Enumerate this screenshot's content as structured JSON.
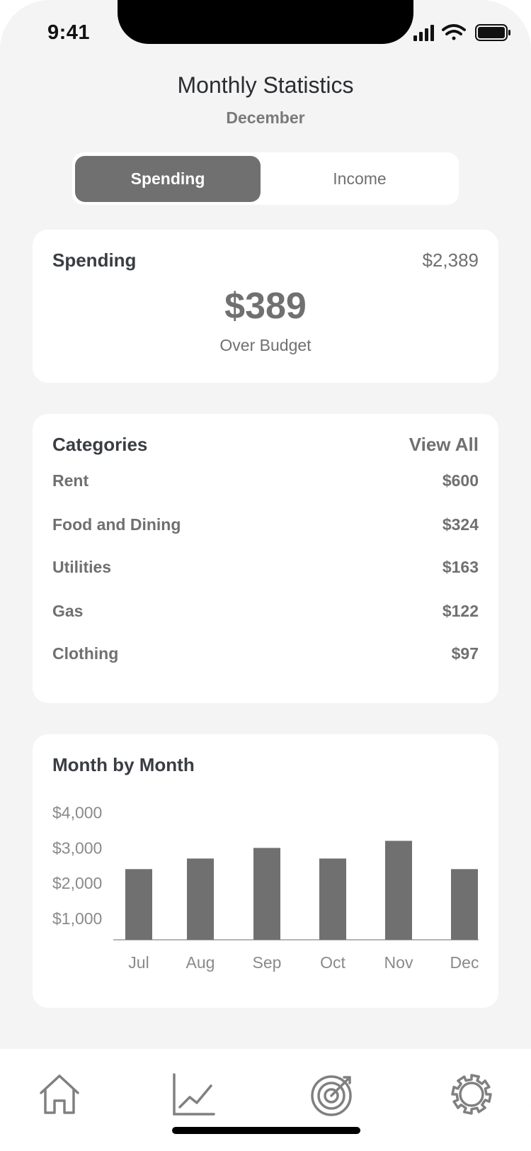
{
  "status_bar": {
    "time": "9:41"
  },
  "header": {
    "title": "Monthly Statistics",
    "subtitle": "December"
  },
  "segmented_control": {
    "selected": "Spending",
    "options": [
      "Spending",
      "Income"
    ]
  },
  "spending_card": {
    "label": "Spending",
    "total": "$2,389",
    "amount": "$389",
    "caption": "Over Budget"
  },
  "categories_card": {
    "title": "Categories",
    "view_all": "View All",
    "items": [
      {
        "name": "Rent",
        "value": "$600"
      },
      {
        "name": "Food and Dining",
        "value": "$324"
      },
      {
        "name": "Utilities",
        "value": "$163"
      },
      {
        "name": "Gas",
        "value": "$122"
      },
      {
        "name": "Clothing",
        "value": "$97"
      }
    ]
  },
  "chart_card": {
    "title": "Month by Month"
  },
  "chart_data": {
    "type": "bar",
    "title": "Month by Month",
    "categories": [
      "Jul",
      "Aug",
      "Sep",
      "Oct",
      "Nov",
      "Dec"
    ],
    "values": [
      2400,
      2700,
      3000,
      2700,
      3200,
      2400
    ],
    "ytick_labels": [
      "$1,000",
      "$2,000",
      "$3,000",
      "$4,000"
    ],
    "yticks": [
      1000,
      2000,
      3000,
      4000
    ],
    "ylim": [
      400,
      4000
    ],
    "grid": false,
    "bar_color": "#707070"
  },
  "tab_bar": {
    "tabs": [
      {
        "name": "home",
        "icon": "home-icon"
      },
      {
        "name": "stats",
        "icon": "chart-icon"
      },
      {
        "name": "goals",
        "icon": "target-icon"
      },
      {
        "name": "settings",
        "icon": "gear-icon"
      }
    ]
  },
  "colors": {
    "background": "#f4f4f4",
    "accent_gray": "#707070",
    "card": "#ffffff"
  }
}
